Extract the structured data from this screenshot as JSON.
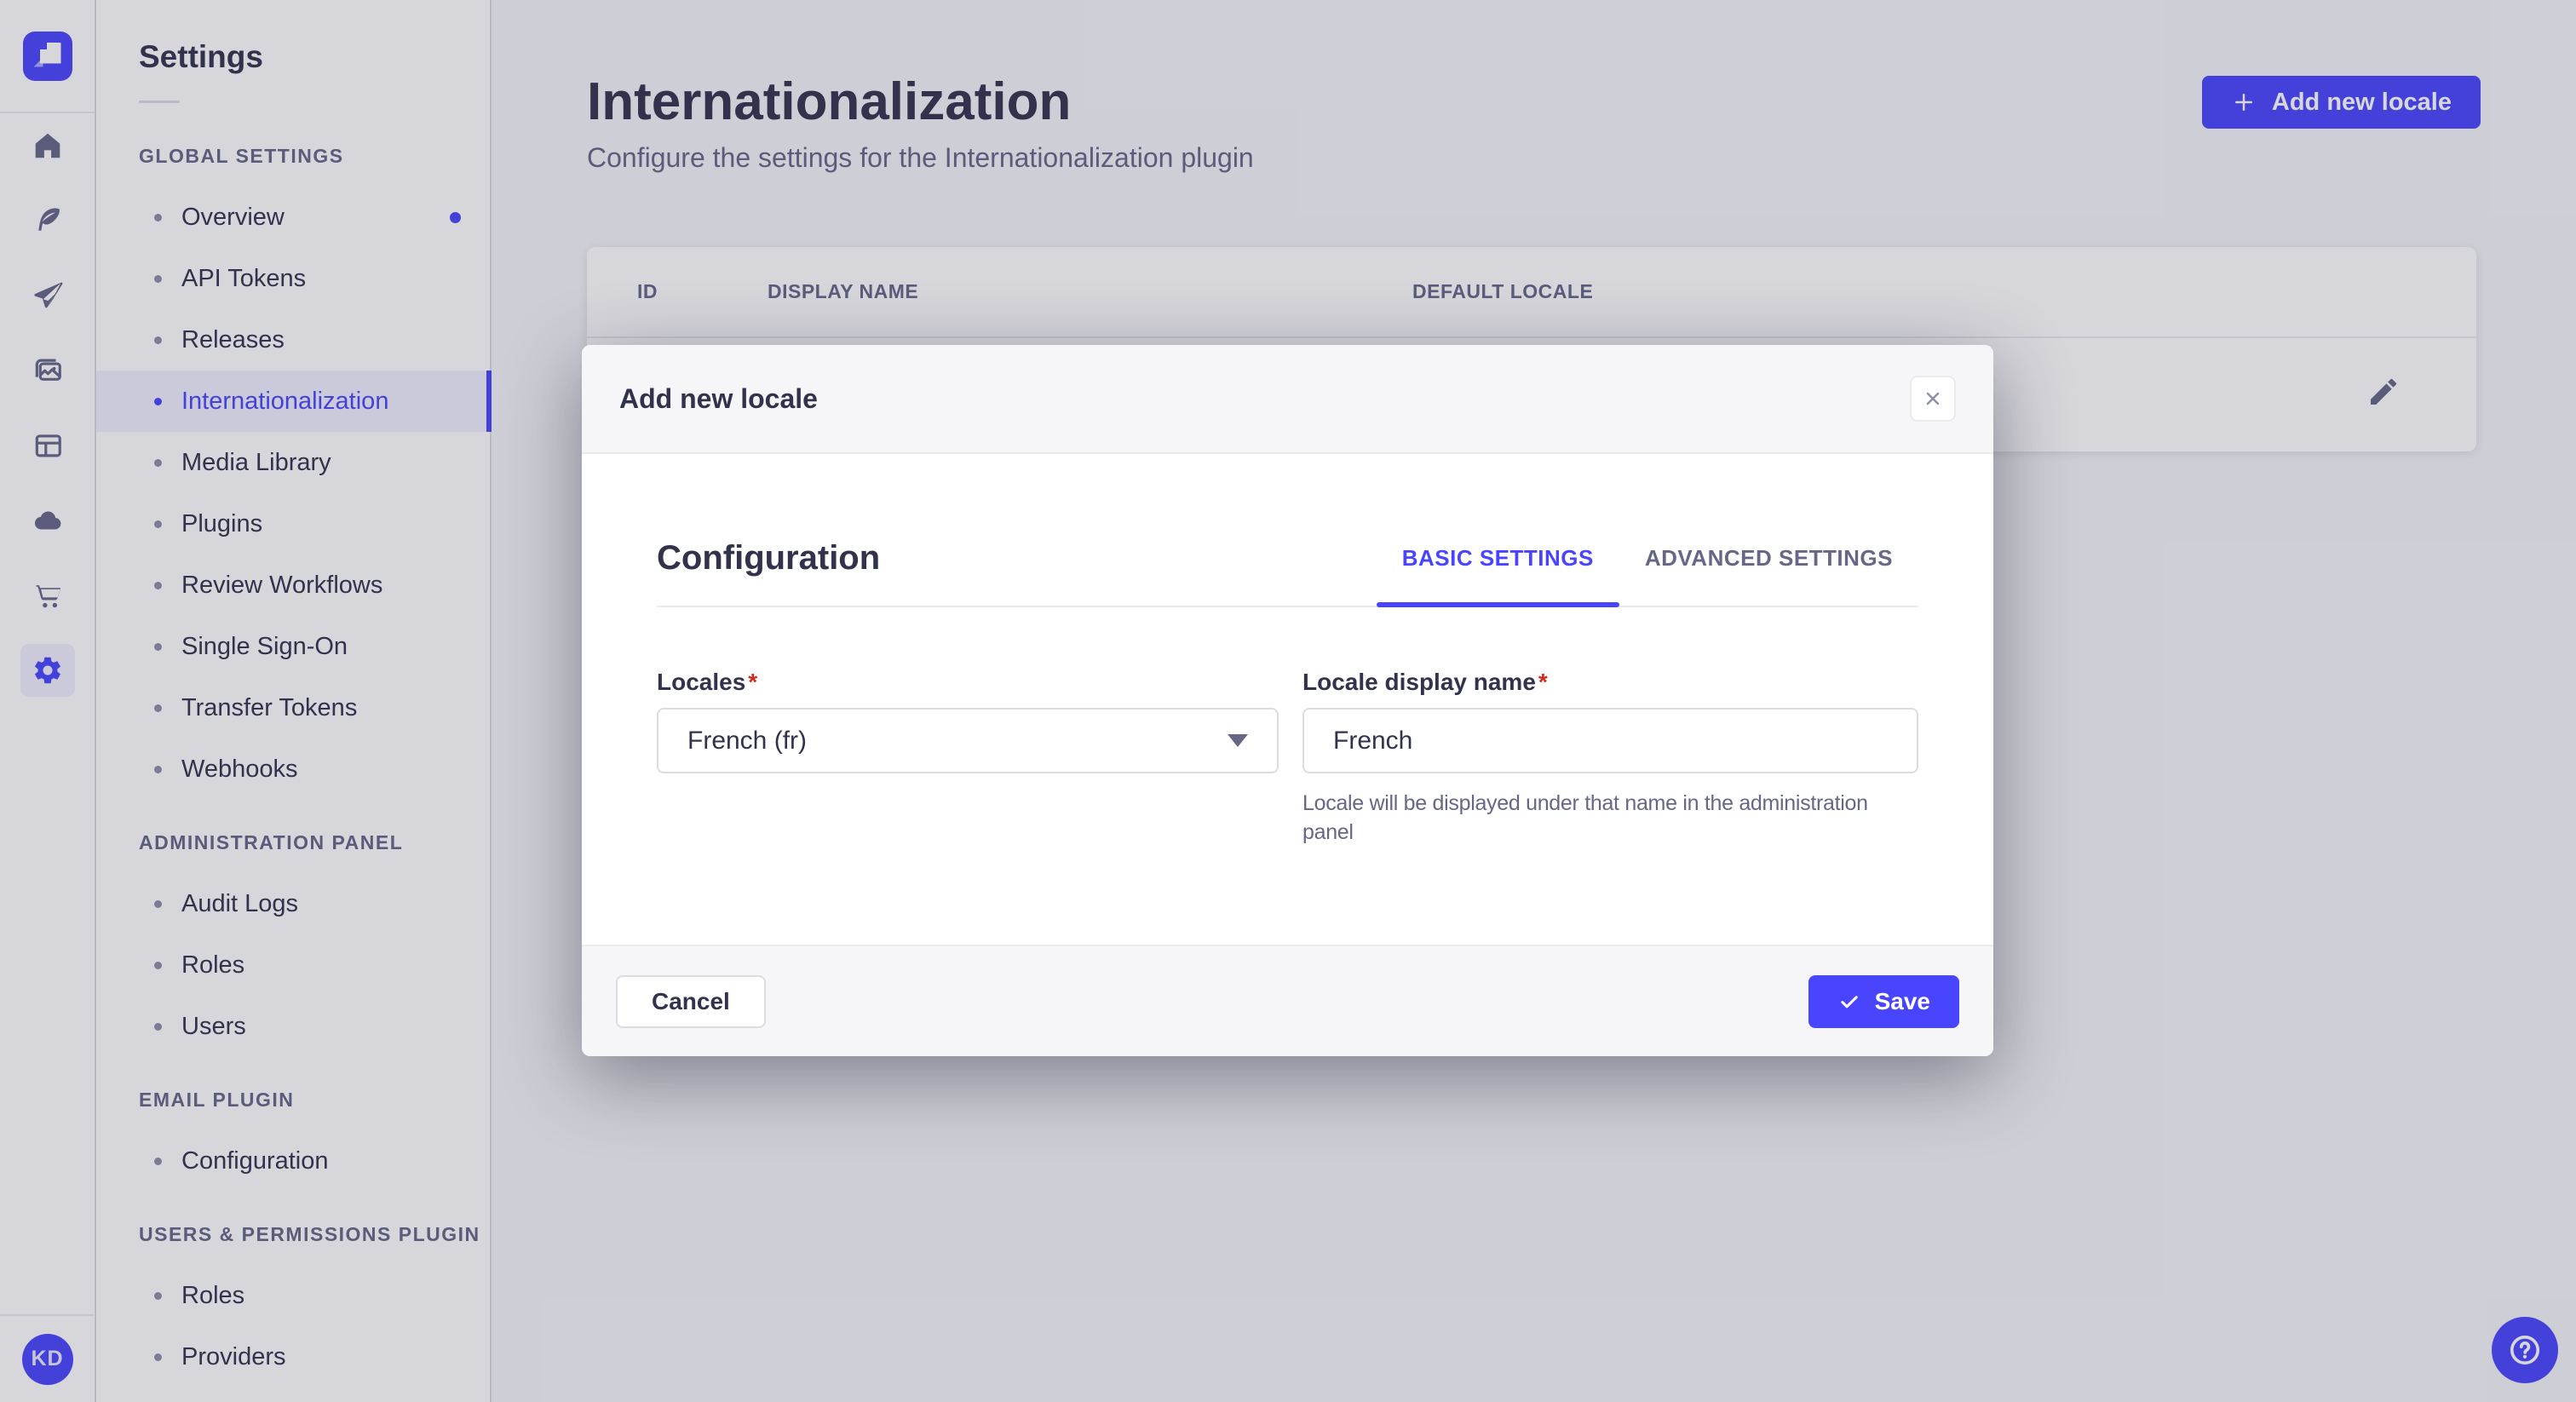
{
  "colors": {
    "primary": "#4945ff",
    "text": "#32324d",
    "muted": "#666687",
    "border": "#dcdce4",
    "danger": "#d02b20",
    "active_bg": "#f0f0ff"
  },
  "rail": {
    "avatar_initials": "KD",
    "icons": [
      "strapi-logo",
      "home",
      "content-manager",
      "releases",
      "media-library",
      "content-type-builder",
      "cloud",
      "marketplace",
      "settings"
    ]
  },
  "sidebar": {
    "title": "Settings",
    "sections": [
      {
        "label": "GLOBAL SETTINGS",
        "items": [
          {
            "label": "Overview"
          },
          {
            "label": "API Tokens"
          },
          {
            "label": "Releases"
          },
          {
            "label": "Internationalization"
          },
          {
            "label": "Media Library"
          },
          {
            "label": "Plugins"
          },
          {
            "label": "Review Workflows"
          },
          {
            "label": "Single Sign-On"
          },
          {
            "label": "Transfer Tokens"
          },
          {
            "label": "Webhooks"
          }
        ]
      },
      {
        "label": "ADMINISTRATION PANEL",
        "items": [
          {
            "label": "Audit Logs"
          },
          {
            "label": "Roles"
          },
          {
            "label": "Users"
          }
        ]
      },
      {
        "label": "EMAIL PLUGIN",
        "items": [
          {
            "label": "Configuration"
          }
        ]
      },
      {
        "label": "USERS & PERMISSIONS PLUGIN",
        "items": [
          {
            "label": "Roles"
          },
          {
            "label": "Providers"
          }
        ]
      }
    ]
  },
  "header": {
    "title": "Internationalization",
    "subtitle": "Configure the settings for the Internationalization plugin",
    "add_button": "Add new locale"
  },
  "table": {
    "columns": [
      "ID",
      "DISPLAY NAME",
      "DEFAULT LOCALE"
    ]
  },
  "modal": {
    "title": "Add new locale",
    "section_title": "Configuration",
    "required_mark": "*",
    "tabs": [
      {
        "label": "BASIC SETTINGS"
      },
      {
        "label": "ADVANCED SETTINGS"
      }
    ],
    "fields": {
      "locales": {
        "label": "Locales",
        "value": "French (fr)"
      },
      "display_name": {
        "label": "Locale display name",
        "value": "French",
        "helper": "Locale will be displayed under that name in the administration panel"
      }
    },
    "footer": {
      "cancel": "Cancel",
      "save": "Save"
    }
  }
}
